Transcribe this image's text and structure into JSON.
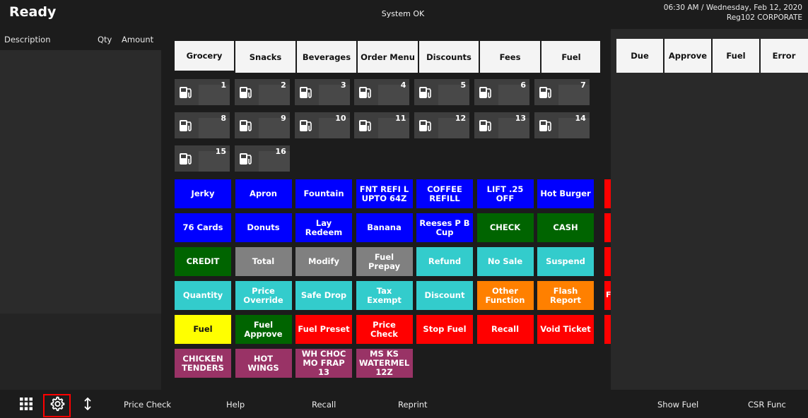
{
  "header": {
    "status": "Ready",
    "system_status": "System OK",
    "datetime": "06:30 AM / Wednesday, Feb 12, 2020",
    "register": "Reg102  CORPORATE"
  },
  "receipt": {
    "col_description": "Description",
    "col_qty": "Qty",
    "col_amount": "Amount"
  },
  "tabs": [
    "Grocery",
    "Snacks",
    "Beverages",
    "Order Menu",
    "Discounts",
    "Fees",
    "Fuel"
  ],
  "selected_tab": "Grocery",
  "pumps": [
    "1",
    "2",
    "3",
    "4",
    "5",
    "6",
    "7",
    "8",
    "9",
    "10",
    "11",
    "12",
    "13",
    "14",
    "15",
    "16"
  ],
  "button_rows": [
    [
      {
        "label": "Jerky",
        "color": "blue"
      },
      {
        "label": "Apron",
        "color": "blue"
      },
      {
        "label": "Fountain",
        "color": "blue"
      },
      {
        "label": "FNT REFI L UPTO 64Z",
        "color": "blue"
      },
      {
        "label": "COFFEE REFILL",
        "color": "blue"
      },
      {
        "label": "LIFT .25 OFF",
        "color": "blue"
      },
      {
        "label": "Hot Burger",
        "color": "blue"
      }
    ],
    [
      {
        "label": "76 Cards",
        "color": "blue"
      },
      {
        "label": "Donuts",
        "color": "blue"
      },
      {
        "label": "Lay Redeem",
        "color": "blue"
      },
      {
        "label": "Banana",
        "color": "blue"
      },
      {
        "label": "Reeses P B Cup",
        "color": "blue"
      },
      {
        "label": "CHECK",
        "color": "green"
      },
      {
        "label": "CASH",
        "color": "green"
      }
    ],
    [
      {
        "label": "CREDIT",
        "color": "green"
      },
      {
        "label": "Total",
        "color": "gray"
      },
      {
        "label": "Modify",
        "color": "gray"
      },
      {
        "label": "Fuel Prepay",
        "color": "gray"
      },
      {
        "label": "Refund",
        "color": "teal"
      },
      {
        "label": "No Sale",
        "color": "teal"
      },
      {
        "label": "Suspend",
        "color": "teal"
      }
    ],
    [
      {
        "label": "Quantity",
        "color": "teal"
      },
      {
        "label": "Price Override",
        "color": "teal"
      },
      {
        "label": "Safe Drop",
        "color": "teal"
      },
      {
        "label": "Tax Exempt",
        "color": "teal"
      },
      {
        "label": "Discount",
        "color": "teal"
      },
      {
        "label": "Other Function",
        "color": "orange"
      },
      {
        "label": "Flash Report",
        "color": "orange"
      }
    ],
    [
      {
        "label": "Fuel",
        "color": "yellow"
      },
      {
        "label": "Fuel Approve",
        "color": "green"
      },
      {
        "label": "Fuel Preset",
        "color": "red"
      },
      {
        "label": "Price Check",
        "color": "red"
      },
      {
        "label": "Stop Fuel",
        "color": "red"
      },
      {
        "label": "Recall",
        "color": "red"
      },
      {
        "label": "Void Ticket",
        "color": "red"
      }
    ],
    [
      {
        "label": "CHICKEN TENDERS",
        "color": "plum"
      },
      {
        "label": "HOT WINGS",
        "color": "plum"
      },
      {
        "label": "WH CHOC MO FRAP 13",
        "color": "plum"
      },
      {
        "label": "MS KS WATERMEL 12Z",
        "color": "plum"
      }
    ]
  ],
  "overflow_strip_labels": [
    "",
    "",
    "",
    "F",
    "",
    ""
  ],
  "right_tabs": [
    "Due",
    "Approve",
    "Fuel",
    "Error"
  ],
  "toolbar": {
    "icons": [
      "apps-grid-icon",
      "gear-icon",
      "up-down-arrow-icon"
    ],
    "labels": [
      "Price Check",
      "Help",
      "Recall",
      "Reprint",
      "Show Fuel",
      "CSR Func"
    ]
  },
  "colors": {
    "blue": "#0000ff",
    "green": "#006400",
    "gray": "#808080",
    "teal": "#33cccc",
    "orange": "#ff8000",
    "yellow": "#ffff00",
    "red": "#ff0000",
    "plum": "#993366",
    "highlight": "#ff0000"
  }
}
